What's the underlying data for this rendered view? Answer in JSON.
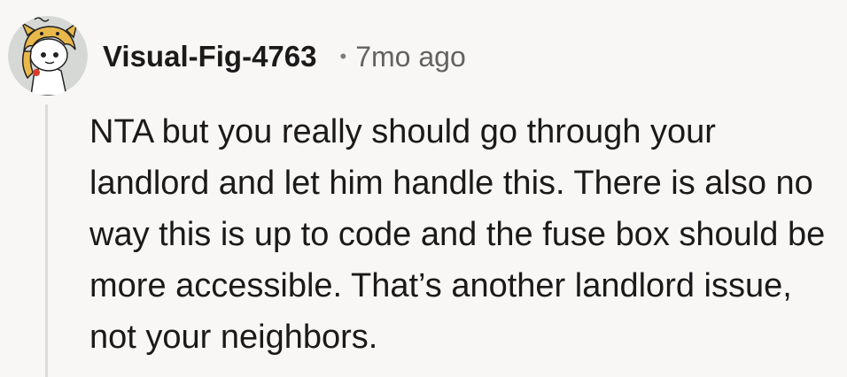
{
  "comment": {
    "author": "Visual-Fig-4763",
    "separator": "•",
    "timestamp": "7mo ago",
    "body": "NTA but you really should go through your landlord and let him handle this. There is also no way this is up to code and the fuse box should be more accessible. That’s another landlord issue, not your neighbors.",
    "avatar": {
      "icon": "snoo-avatar-icon",
      "bg_color": "#d6d8d6",
      "hat_color": "#e8b84a"
    }
  },
  "colors": {
    "background": "#f8f7f5",
    "text": "#1a1a1b",
    "meta": "#626262",
    "thread_line": "#dcdcdc"
  }
}
